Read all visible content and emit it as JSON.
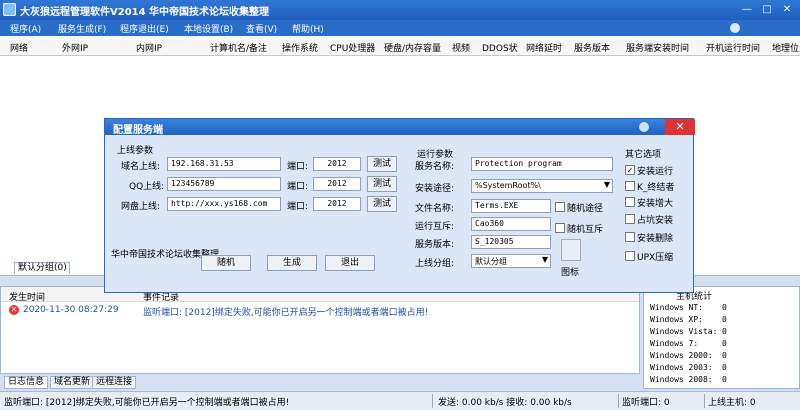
{
  "window": {
    "title": "大灰狼远程管理软件V2014   华中帝国技术论坛收集整理",
    "minimize": "—",
    "maximize": "□",
    "close": "✕"
  },
  "menu": [
    "程序(A)",
    "服务生成(F)",
    "程序退出(E)",
    "本地设置(B)",
    "查看(V)",
    "帮助(H)"
  ],
  "columns": [
    "网络",
    "外网IP",
    "内网IP",
    "计算机名/备注",
    "操作系统",
    "CPU处理器",
    "硬盘/内存容量",
    "视频",
    "DDOS状",
    "网络延时",
    "服务版本",
    "服务端安装时间",
    "开机运行时间",
    "地理位置"
  ],
  "host_tab": "默认分组(0)",
  "log": {
    "headers": [
      "发生时间",
      "事件记录"
    ],
    "rows": [
      {
        "time": "2020-11-30 08:27:29",
        "message": "监听端口: [2012]绑定失败,可能你已开启另一个控制端或者端口被占用!"
      }
    ]
  },
  "bottom_tabs": [
    "日志信息",
    "域名更新",
    "远程连接"
  ],
  "online": {
    "title": "主机统计",
    "rows": [
      {
        "os": "Windows NT:",
        "count": "0"
      },
      {
        "os": "Windows XP:",
        "count": "0"
      },
      {
        "os": "Windows Vista:",
        "count": "0"
      },
      {
        "os": "Windows 7:",
        "count": "0"
      },
      {
        "os": "Windows 2000:",
        "count": "0"
      },
      {
        "os": "Windows 2003:",
        "count": "0"
      },
      {
        "os": "Windows 2008:",
        "count": "0"
      }
    ]
  },
  "status": {
    "message": "监听端口: [2012]绑定失败,可能你已开启另一个控制端或者端口被占用!",
    "traffic": "发送: 0.00 kb/s 接收: 0.00 kb/s",
    "port": "监听端口: 0",
    "hosts": "上线主机: 0"
  },
  "dialog": {
    "title": "配置服务端",
    "close": "✕",
    "online_group": "上线参数",
    "domain_label": "域名上线:",
    "domain_value": "192.168.31.53",
    "qq_label": "QQ上线:",
    "qq_value": "123456789",
    "netdisk_label": "网盘上线:",
    "netdisk_value": "http://xxx.ys168.com",
    "port_label": "端口:",
    "port1": "2012",
    "port2": "2012",
    "port3": "2012",
    "test_button": "测试",
    "watermark": "华中帝国技术论坛收集整理",
    "random_button": "随机",
    "generate_button": "生成",
    "exit_button": "退出",
    "run_group": "运行参数",
    "service_name_label": "服务名称:",
    "service_name_value": "Protection program",
    "install_path_label": "安装途径:",
    "install_path_value": "%SystemRoot%\\",
    "file_name_label": "文件名称:",
    "file_name_value": "Terms.EXE",
    "mutex_label": "运行互斥:",
    "mutex_value": "Cao360",
    "version_label": "服务版本:",
    "version_value": "S_120305",
    "group_label": "上线分组:",
    "group_value": "默认分组",
    "random_path": "随机途径",
    "random_mutex": "随机互斥",
    "icon_label": "图标",
    "other_group": "其它选项",
    "options": [
      {
        "label": "安装运行",
        "checked": true
      },
      {
        "label": "K_终结者",
        "checked": false
      },
      {
        "label": "安装增大",
        "checked": false
      },
      {
        "label": "占坑安装",
        "checked": false
      },
      {
        "label": "安装删除",
        "checked": false
      },
      {
        "label": "UPX压缩",
        "checked": false
      }
    ]
  }
}
